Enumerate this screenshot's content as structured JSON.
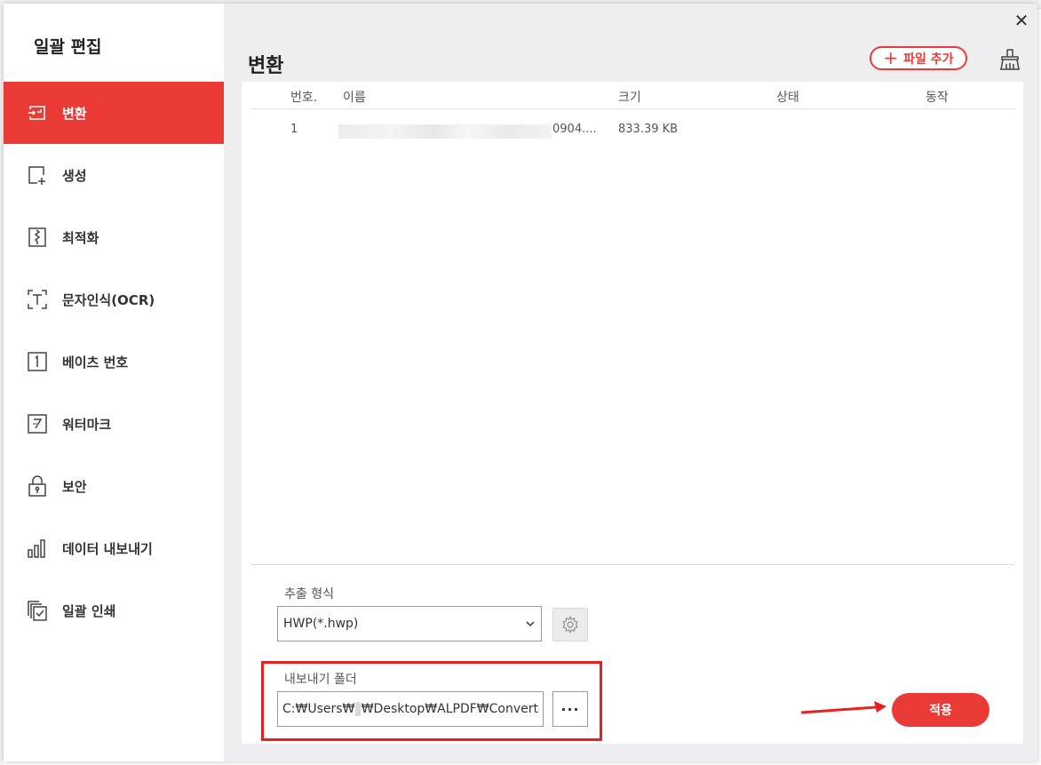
{
  "sidebar": {
    "title": "일괄 편집",
    "items": [
      {
        "label": "변환",
        "icon": "convert-icon",
        "active": true
      },
      {
        "label": "생성",
        "icon": "create-icon",
        "active": false
      },
      {
        "label": "최적화",
        "icon": "optimize-icon",
        "active": false
      },
      {
        "label": "문자인식(OCR)",
        "icon": "ocr-icon",
        "active": false
      },
      {
        "label": "베이츠 번호",
        "icon": "bates-number-icon",
        "active": false
      },
      {
        "label": "워터마크",
        "icon": "watermark-icon",
        "active": false
      },
      {
        "label": "보안",
        "icon": "lock-icon",
        "active": false
      },
      {
        "label": "데이터 내보내기",
        "icon": "data-export-icon",
        "active": false
      },
      {
        "label": "일괄 인쇄",
        "icon": "batch-print-icon",
        "active": false
      }
    ]
  },
  "header": {
    "title": "변환",
    "add_file_label": "파일 추가",
    "close_symbol": "✕"
  },
  "table": {
    "columns": [
      "번호.",
      "이름",
      "크기",
      "상태",
      "동작"
    ],
    "rows": [
      {
        "number": "1",
        "name_visible": "0904....",
        "size": "833.39 KB",
        "status": "",
        "action": ""
      }
    ]
  },
  "output_format": {
    "label": "추출 형식",
    "selected": "HWP(*.hwp)"
  },
  "export_folder": {
    "label": "내보내기 폴더",
    "path_prefix": "C:₩Users₩",
    "path_suffix": "₩Desktop₩ALPDF₩Convert",
    "browse_label": "···"
  },
  "apply_label": "적용",
  "colors": {
    "accent": "#e93a36",
    "highlight": "#e8211f"
  }
}
